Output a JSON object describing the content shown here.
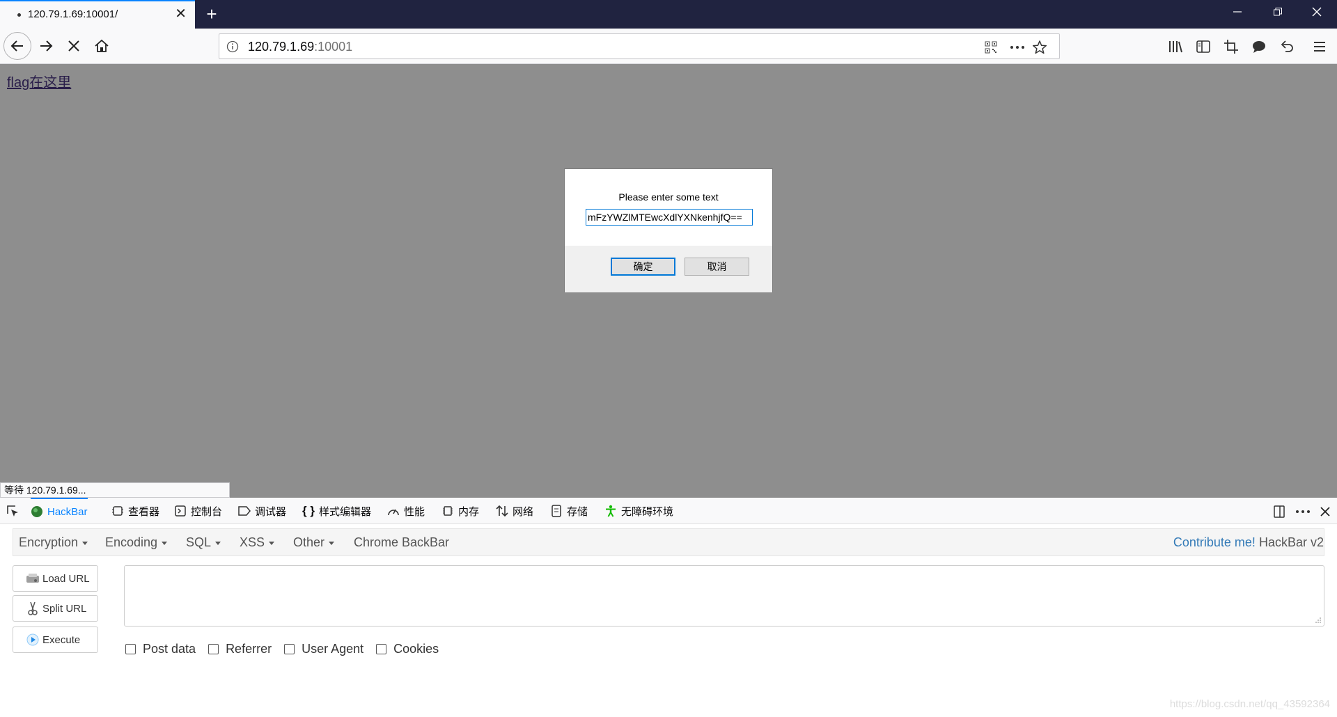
{
  "browser": {
    "tab_title": "120.79.1.69:10001/",
    "url_host": "120.79.1.69",
    "url_port": ":10001"
  },
  "page": {
    "link_text": "flag在这里",
    "status_text": "等待 120.79.1.69..."
  },
  "dialog": {
    "message": "Please enter some text",
    "input_value": "mFzYWZlMTEwcXdlYXNkenhjfQ==",
    "ok_label": "确定",
    "cancel_label": "取消"
  },
  "devtools": {
    "tabs": [
      {
        "label": "HackBar",
        "icon": "hackbar-icon"
      },
      {
        "label": "查看器",
        "icon": "inspector-icon"
      },
      {
        "label": "控制台",
        "icon": "console-icon"
      },
      {
        "label": "调试器",
        "icon": "debugger-icon"
      },
      {
        "label": "样式编辑器",
        "icon": "style-editor-icon"
      },
      {
        "label": "性能",
        "icon": "performance-icon"
      },
      {
        "label": "内存",
        "icon": "memory-icon"
      },
      {
        "label": "网络",
        "icon": "network-icon"
      },
      {
        "label": "存储",
        "icon": "storage-icon"
      },
      {
        "label": "无障碍环境",
        "icon": "accessibility-icon"
      }
    ]
  },
  "hackbar": {
    "menu": [
      "Encryption",
      "Encoding",
      "SQL",
      "XSS",
      "Other"
    ],
    "chrome_backbar": "Chrome BackBar",
    "contribute": "Contribute me!",
    "version": "HackBar v2",
    "buttons": {
      "load_url": "Load URL",
      "split_url": "Split URL",
      "execute": "Execute"
    },
    "checks": [
      "Post data",
      "Referrer",
      "User Agent",
      "Cookies"
    ]
  },
  "watermark": "https://blog.csdn.net/qq_43592364",
  "colors": {
    "accent": "#0a84ff",
    "titlebar": "#202340",
    "overlay": "#8e8e8e",
    "link": "#337ab7"
  }
}
